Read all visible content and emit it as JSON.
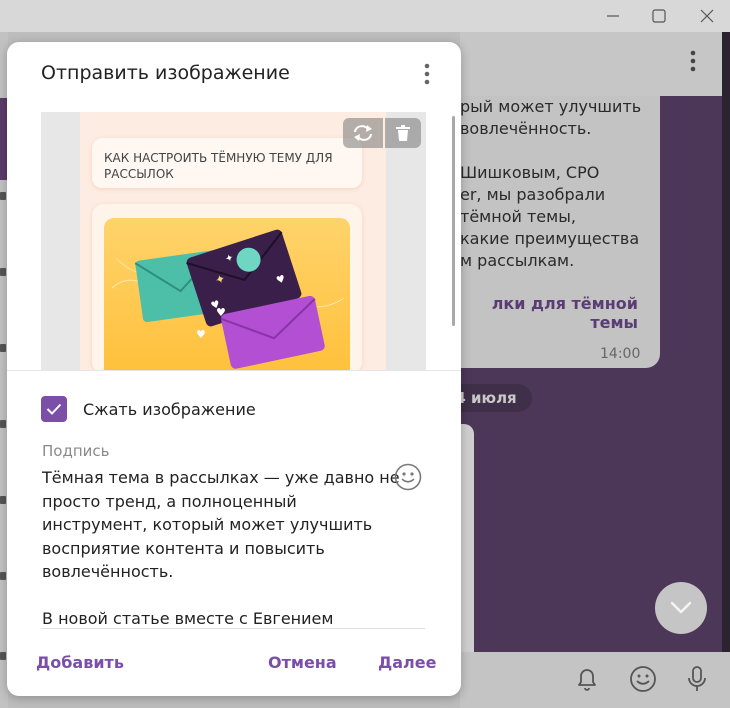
{
  "window": {
    "minimize_icon": "minimize-icon",
    "maximize_icon": "maximize-icon",
    "close_icon": "close-icon"
  },
  "background_chat": {
    "message_text": [
      "рый может улучшить",
      "вовлечённость.",
      "",
      "Шишковым, CPO",
      "er, мы разобрали",
      "тёмной темы,",
      "какие преимущества",
      "м рассылкам."
    ],
    "link_text": "лки для тёмной темы",
    "time": "14:00",
    "date_pill": "4 июля"
  },
  "dialog": {
    "title": "Отправить изображение",
    "preview": {
      "card_title": "КАК НАСТРОИТЬ ТЁМНУЮ ТЕМУ ДЛЯ РАССЫЛОК",
      "replace_icon": "replace-icon",
      "delete_icon": "trash-icon"
    },
    "compress_label": "Сжать изображение",
    "compress_checked": true,
    "caption_label": "Подпись",
    "caption_lines": [
      "Тёмная тема в рассылках — уже давно не",
      "просто тренд, а полноценный",
      "инструмент, который может улучшить",
      "восприятие контента и повысить",
      "вовлечённость.",
      "",
      "В новой статье вместе с Евгением"
    ],
    "buttons": {
      "add": "Добавить",
      "cancel": "Отмена",
      "next": "Далее"
    }
  },
  "colors": {
    "accent": "#7b4ea7",
    "chat_bg": "#4d3758"
  }
}
